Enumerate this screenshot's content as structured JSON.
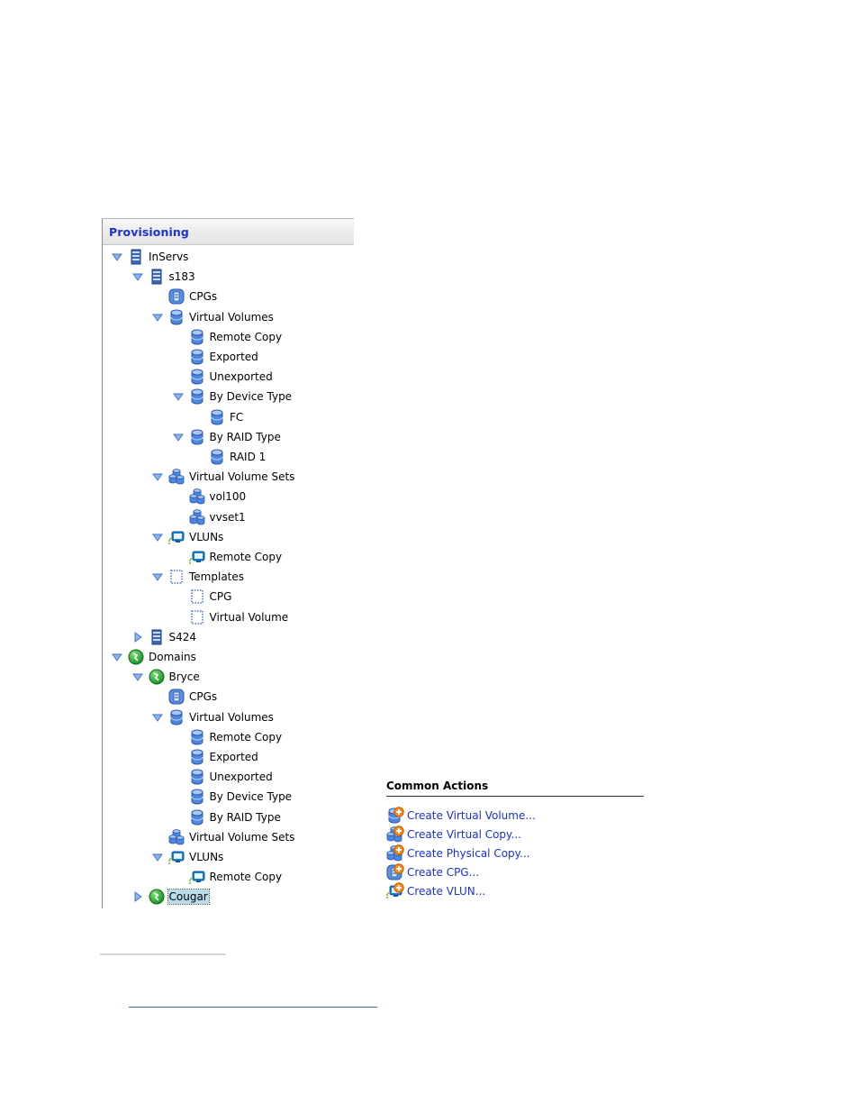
{
  "panel": {
    "title": "Provisioning"
  },
  "tree": [
    {
      "label": "InServs",
      "level": 0,
      "expander": "expanded",
      "icon": "server-icon"
    },
    {
      "label": "s183",
      "level": 1,
      "expander": "expanded",
      "icon": "server-icon"
    },
    {
      "label": "CPGs",
      "level": 2,
      "expander": "none",
      "icon": "cpg-icon"
    },
    {
      "label": "Virtual Volumes",
      "level": 2,
      "expander": "expanded",
      "icon": "database-icon"
    },
    {
      "label": "Remote Copy",
      "level": 3,
      "expander": "none",
      "icon": "database-icon"
    },
    {
      "label": "Exported",
      "level": 3,
      "expander": "none",
      "icon": "database-icon"
    },
    {
      "label": "Unexported",
      "level": 3,
      "expander": "none",
      "icon": "database-icon"
    },
    {
      "label": "By Device Type",
      "level": 3,
      "expander": "expanded",
      "icon": "database-icon"
    },
    {
      "label": "FC",
      "level": 4,
      "expander": "none",
      "icon": "database-icon"
    },
    {
      "label": "By RAID Type",
      "level": 3,
      "expander": "expanded",
      "icon": "database-icon"
    },
    {
      "label": "RAID 1",
      "level": 4,
      "expander": "none",
      "icon": "database-icon"
    },
    {
      "label": "Virtual Volume Sets",
      "level": 2,
      "expander": "expanded",
      "icon": "volume-set-icon"
    },
    {
      "label": "vol100",
      "level": 3,
      "expander": "none",
      "icon": "volume-set-icon"
    },
    {
      "label": "vvset1",
      "level": 3,
      "expander": "none",
      "icon": "volume-set-icon"
    },
    {
      "label": "VLUNs",
      "level": 2,
      "expander": "expanded",
      "icon": "vlun-icon"
    },
    {
      "label": "Remote Copy",
      "level": 3,
      "expander": "none",
      "icon": "vlun-icon"
    },
    {
      "label": "Templates",
      "level": 2,
      "expander": "expanded",
      "icon": "template-icon"
    },
    {
      "label": "CPG",
      "level": 3,
      "expander": "none",
      "icon": "template-icon"
    },
    {
      "label": "Virtual Volume",
      "level": 3,
      "expander": "none",
      "icon": "template-icon"
    },
    {
      "label": "S424",
      "level": 1,
      "expander": "collapsed",
      "icon": "server-icon"
    },
    {
      "label": "Domains",
      "level": 0,
      "expander": "expanded",
      "icon": "domain-globe-icon"
    },
    {
      "label": "Bryce",
      "level": 1,
      "expander": "expanded",
      "icon": "domain-globe-icon"
    },
    {
      "label": "CPGs",
      "level": 2,
      "expander": "none",
      "icon": "cpg-icon"
    },
    {
      "label": "Virtual Volumes",
      "level": 2,
      "expander": "expanded",
      "icon": "database-icon"
    },
    {
      "label": "Remote Copy",
      "level": 3,
      "expander": "none",
      "icon": "database-icon"
    },
    {
      "label": "Exported",
      "level": 3,
      "expander": "none",
      "icon": "database-icon"
    },
    {
      "label": "Unexported",
      "level": 3,
      "expander": "none",
      "icon": "database-icon"
    },
    {
      "label": "By Device Type",
      "level": 3,
      "expander": "none",
      "icon": "database-icon"
    },
    {
      "label": "By RAID Type",
      "level": 3,
      "expander": "none",
      "icon": "database-icon"
    },
    {
      "label": "Virtual Volume Sets",
      "level": 2,
      "expander": "none",
      "icon": "volume-set-icon"
    },
    {
      "label": "VLUNs",
      "level": 2,
      "expander": "expanded",
      "icon": "vlun-icon"
    },
    {
      "label": "Remote Copy",
      "level": 3,
      "expander": "none",
      "icon": "vlun-icon"
    },
    {
      "label": "Cougar",
      "level": 1,
      "expander": "collapsed",
      "icon": "domain-globe-icon",
      "selected": true
    }
  ],
  "common_actions": {
    "title": "Common Actions",
    "items": [
      {
        "label": "Create Virtual Volume...",
        "icon": "create-virtual-volume-icon"
      },
      {
        "label": "Create Virtual Copy...",
        "icon": "create-virtual-copy-icon"
      },
      {
        "label": "Create Physical Copy...",
        "icon": "create-physical-copy-icon"
      },
      {
        "label": "Create CPG...",
        "icon": "create-cpg-icon"
      },
      {
        "label": "Create VLUN...",
        "icon": "create-vlun-icon"
      }
    ]
  },
  "colors": {
    "title_blue": "#1c32d4",
    "link_blue": "#1a2fd6",
    "selection": "#b7dcea"
  }
}
